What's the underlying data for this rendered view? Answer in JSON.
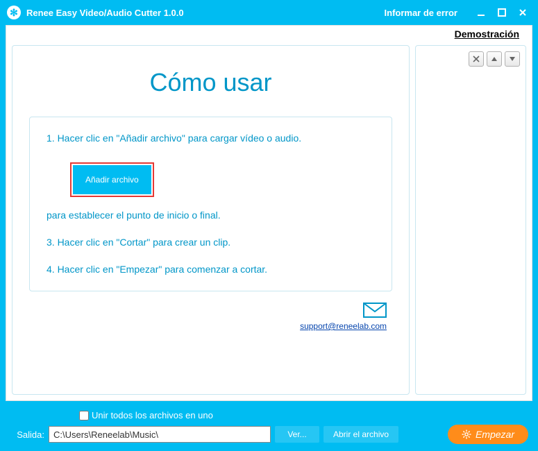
{
  "titlebar": {
    "app_title": "Renee Easy Video/Audio Cutter 1.0.0",
    "report_error": "Informar de error"
  },
  "topbar": {
    "demo_link": "Demostración"
  },
  "howto": {
    "title": "Cómo usar",
    "step1": "1. Hacer clic en \"Añadir archivo\" para cargar vídeo o audio.",
    "add_button": "Añadir archivo",
    "step2_tail": "para establecer el punto de inicio o final.",
    "step3": "3. Hacer clic en \"Cortar\" para crear un clip.",
    "step4": "4. Hacer clic en \"Empezar\" para comenzar a cortar."
  },
  "support": {
    "email": "support@reneelab.com"
  },
  "bottombar": {
    "merge_label": "Unir todos los archivos en uno",
    "output_label": "Salida:",
    "output_path": "C:\\Users\\Reneelab\\Music\\",
    "browse_label": "Ver...",
    "open_label": "Abrir el archivo",
    "start_label": "Empezar"
  },
  "colors": {
    "brand_blue": "#00bcf2",
    "accent_orange": "#ff8c1a",
    "text_teal": "#0096c8",
    "highlight_red": "#e53935"
  }
}
